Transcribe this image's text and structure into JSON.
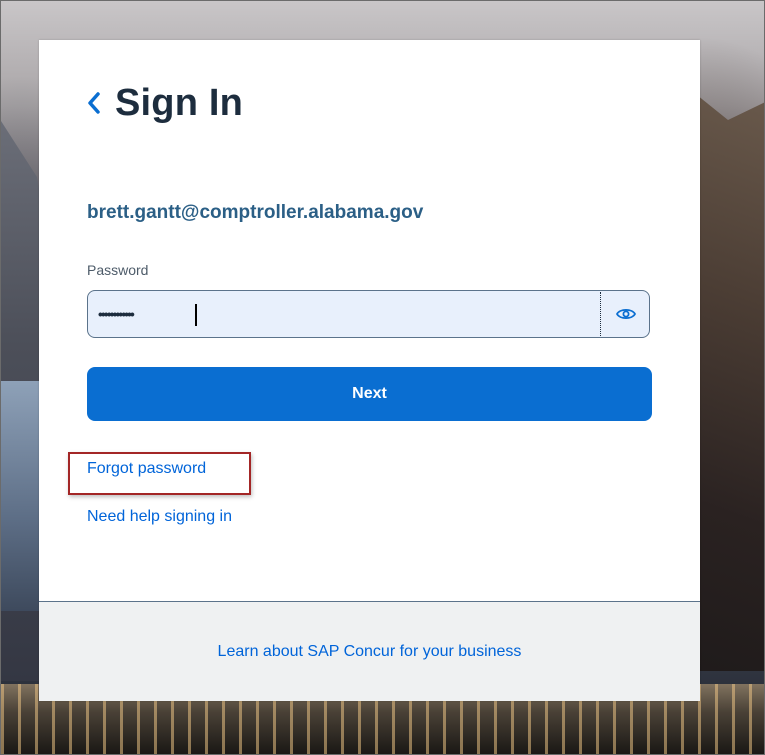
{
  "header": {
    "title": "Sign In",
    "back_icon": "chevron-left-icon"
  },
  "account": {
    "email": "brett.gantt@comptroller.alabama.gov"
  },
  "password": {
    "label": "Password",
    "value": "••••••••••••",
    "toggle_icon": "eye-icon"
  },
  "actions": {
    "next_label": "Next",
    "forgot_label": "Forgot password",
    "help_label": "Need help signing in"
  },
  "footer": {
    "link_label": "Learn about SAP Concur for your business"
  },
  "colors": {
    "primary": "#0a6ed1",
    "link": "#0064d9",
    "title": "#1d2d3e",
    "email": "#2b5f86",
    "highlight_border": "#a32626",
    "input_bg": "#e8f0fc",
    "footer_bg": "#eff1f2"
  }
}
